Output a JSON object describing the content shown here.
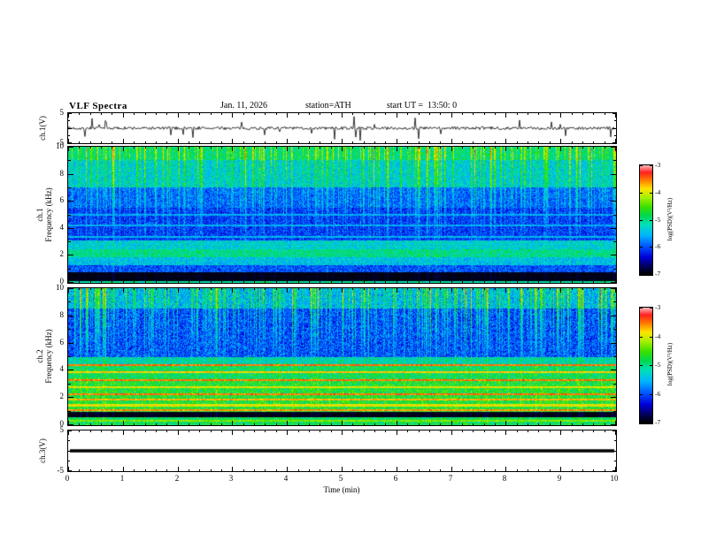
{
  "header": {
    "title": "VLF Spectra",
    "date": "Jan. 11, 2026",
    "station": "station=ATH",
    "start_ut": "start UT =  13:50: 0"
  },
  "xaxis": {
    "label": "Time (min)",
    "min": 0,
    "max": 10,
    "tick_labels": [
      "0",
      "1",
      "2",
      "3",
      "4",
      "5",
      "6",
      "7",
      "8",
      "9",
      "10"
    ]
  },
  "colorbar": {
    "label": "log(PSD)(V²/Hz)",
    "min": -7,
    "max": -3,
    "tick_labels": [
      "-3",
      "-4",
      "-5",
      "-6",
      "-7"
    ]
  },
  "colormap": [
    [
      0.0,
      "#000000"
    ],
    [
      0.06,
      "#000046"
    ],
    [
      0.16,
      "#0000d8"
    ],
    [
      0.26,
      "#0055ff"
    ],
    [
      0.36,
      "#00b4ff"
    ],
    [
      0.46,
      "#00e0b8"
    ],
    [
      0.54,
      "#00d850"
    ],
    [
      0.62,
      "#38e000"
    ],
    [
      0.71,
      "#a8f000"
    ],
    [
      0.79,
      "#ffe400"
    ],
    [
      0.87,
      "#ff7800"
    ],
    [
      0.94,
      "#ff2020"
    ],
    [
      1.0,
      "#ffb4b4"
    ]
  ],
  "chart_data": [
    {
      "id": "ch1_waveform",
      "type": "line",
      "ylabel": "ch.1(V)",
      "ylim": [
        -5,
        5
      ],
      "ytick_labels": [
        "5",
        "-5"
      ],
      "xlim": [
        0,
        10
      ],
      "description": "broadband noise around 0 V with dense impulsive sferic spikes up to about ±4 V",
      "signal": {
        "seed": 7,
        "baseline": 0,
        "noise_v": 0.5,
        "spike_prob": 0.06,
        "spike_max_v": 3.8,
        "flat": false
      }
    },
    {
      "id": "ch1_spectrogram",
      "type": "heatmap",
      "ylabel_ch": "ch.1",
      "ylabel_freq": "Frequency (kHz)",
      "ylim": [
        0,
        10
      ],
      "ytick_labels": [
        "10",
        "8",
        "6",
        "4",
        "2",
        "0"
      ],
      "xlim": [
        0,
        10
      ],
      "zlim": [
        -7,
        -3
      ],
      "seed": 11,
      "noise_psd": 0.38,
      "bands": [
        {
          "f": [
            9.0,
            10.01
          ],
          "psd": -5.0
        },
        {
          "f": [
            7.0,
            9.0
          ],
          "psd": -5.35
        },
        {
          "f": [
            5.5,
            7.0
          ],
          "psd": -5.9
        },
        {
          "f": [
            3.1,
            5.5
          ],
          "psd": -6.1
        },
        {
          "f": [
            2.5,
            3.1
          ],
          "psd": -5.35
        },
        {
          "f": [
            1.9,
            2.5
          ],
          "psd": -5.05
        },
        {
          "f": [
            1.3,
            1.9
          ],
          "psd": -5.45
        },
        {
          "f": [
            0.75,
            1.3
          ],
          "psd": -6.0
        },
        {
          "f": [
            0.15,
            0.75
          ],
          "psd": -6.95
        },
        {
          "f": [
            0.0,
            0.15
          ],
          "psd": -5.1
        }
      ],
      "hlines": [
        {
          "f": 5.0,
          "psd": -5.55
        },
        {
          "f": 4.2,
          "psd": -5.55
        },
        {
          "f": 3.4,
          "psd": -5.5
        }
      ],
      "streaks": {
        "density": 0.45,
        "max_boost": 1.1,
        "strong_count": 30,
        "strong_boost": 1.6,
        "fmin": 2.5,
        "low_weight": 0.12
      }
    },
    {
      "id": "ch2_spectrogram",
      "type": "heatmap",
      "ylabel_ch": "ch.2",
      "ylabel_freq": "Frequency (kHz)",
      "ylim": [
        0,
        10
      ],
      "ytick_labels": [
        "10",
        "8",
        "6",
        "4",
        "2",
        "0"
      ],
      "xlim": [
        0,
        10
      ],
      "zlim": [
        -7,
        -3
      ],
      "seed": 23,
      "noise_psd": 0.45,
      "bands": [
        {
          "f": [
            8.5,
            10.01
          ],
          "psd": -5.5
        },
        {
          "f": [
            5.0,
            8.5
          ],
          "psd": -6.0
        },
        {
          "f": [
            4.3,
            5.0
          ],
          "psd": -5.2
        },
        {
          "f": [
            3.4,
            4.3
          ],
          "psd": -4.9
        },
        {
          "f": [
            1.0,
            3.4
          ],
          "psd": -4.75
        },
        {
          "f": [
            0.55,
            1.0
          ],
          "psd": -6.95
        },
        {
          "f": [
            0.0,
            0.55
          ],
          "psd": -4.9
        }
      ],
      "hlines": [
        {
          "f": 4.4,
          "psd": -3.5
        },
        {
          "f": 3.85,
          "psd": -3.8
        },
        {
          "f": 3.3,
          "psd": -3.5
        },
        {
          "f": 2.75,
          "psd": -3.9
        },
        {
          "f": 2.25,
          "psd": -3.5
        },
        {
          "f": 1.85,
          "psd": -3.7
        },
        {
          "f": 1.45,
          "psd": -3.9
        },
        {
          "f": 1.1,
          "psd": -3.6
        },
        {
          "f": 0.3,
          "psd": -4.3
        }
      ],
      "streaks": {
        "density": 0.45,
        "max_boost": 1.2,
        "strong_count": 34,
        "strong_boost": 1.9,
        "fmin": 4.4,
        "low_weight": 0.16
      }
    },
    {
      "id": "ch3_waveform",
      "type": "line",
      "ylabel": "ch.3(V)",
      "ylim": [
        -5,
        5
      ],
      "ytick_labels": [
        "5",
        "-5"
      ],
      "xlim": [
        0,
        10
      ],
      "description": "flat line at 0 V (channel off)",
      "signal": {
        "seed": 3,
        "baseline": 0,
        "noise_v": 0,
        "spike_prob": 0,
        "spike_max_v": 0,
        "flat": true
      }
    }
  ]
}
